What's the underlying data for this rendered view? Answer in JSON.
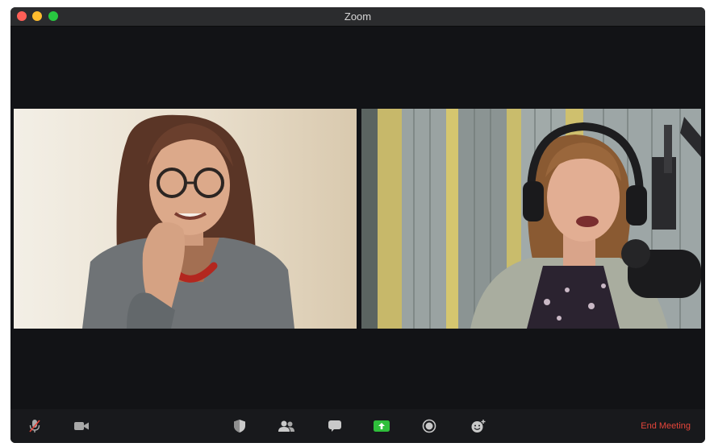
{
  "window": {
    "title": "Zoom"
  },
  "participants": [
    {
      "video": "woman-with-glasses-video"
    },
    {
      "video": "woman-with-headphones-video"
    }
  ],
  "toolbar": {
    "items": [
      {
        "icon": "microphone-muted-icon"
      },
      {
        "icon": "video-camera-icon"
      },
      {
        "icon": "security-shield-icon"
      },
      {
        "icon": "participants-icon"
      },
      {
        "icon": "chat-icon"
      },
      {
        "icon": "share-screen-icon",
        "color": "#2fbf3b"
      },
      {
        "icon": "record-icon"
      },
      {
        "icon": "reactions-icon"
      }
    ],
    "end_label": "End Meeting",
    "end_color": "#e5453a"
  }
}
